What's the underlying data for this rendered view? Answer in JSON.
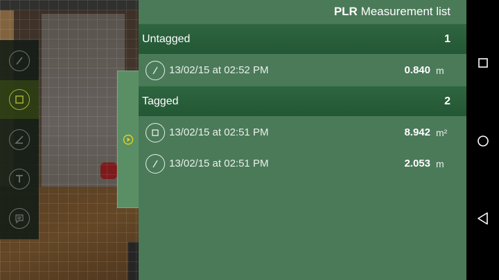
{
  "panel": {
    "title_brand": "PLR",
    "title_text": "Measurement list"
  },
  "sections": [
    {
      "label": "Untagged",
      "count": "1",
      "rows": [
        {
          "icon": "line-measure-icon",
          "datetime": "13/02/15 at 02:52 PM",
          "value": "0.840",
          "unit": "m"
        }
      ]
    },
    {
      "label": "Tagged",
      "count": "2",
      "rows": [
        {
          "icon": "area-measure-icon",
          "datetime": "13/02/15 at 02:51 PM",
          "value": "8.942",
          "unit": "m²"
        },
        {
          "icon": "line-measure-icon",
          "datetime": "13/02/15 at 02:51 PM",
          "value": "2.053",
          "unit": "m"
        }
      ]
    }
  ],
  "tools": [
    "line-tool-icon",
    "area-tool-icon",
    "angle-tool-icon",
    "text-tool-icon",
    "comment-tool-icon"
  ],
  "nav": [
    "recents-icon",
    "home-icon",
    "back-icon"
  ],
  "colors": {
    "panel": "#4b7a59",
    "section_header": "#235735",
    "active_tool": "#a8b42a",
    "tab_icon": "#e6d21a"
  }
}
